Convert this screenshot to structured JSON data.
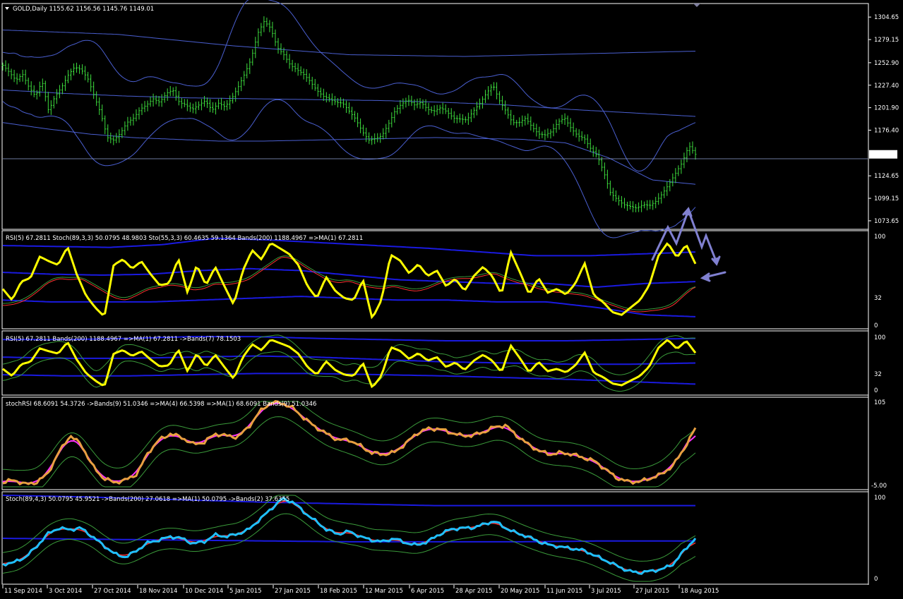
{
  "header": {
    "main": "GOLD,Daily  1155.62 1156.56 1145.76 1149.01",
    "rsi": "RSI(5) 67.2811  Stoch(89,3,3) 50.0795 48.9803  Sto(55,3,3) 60.4635 59.1364  Bands(200) 1188.4967  =>MA(1) 67.2811",
    "rsi2": "RSI(5) 67.2811  Bands(200) 1188.4967  =>MA(1) 67.2811  ->Bands(7) 78.1503",
    "stochrsi": "stochRSI 68.6091 54.3726  ->Bands(9) 51.0346  =>MA(4) 66.5398  =>MA(1) 68.6091  Bands(9) 51.0346",
    "stoch": "Stoch(89,4,3) 50.0795 45.9521  ->Bands(200) 27.0618  =>MA(1) 50.0795  ->Bands(2) 37.6355"
  },
  "colors": {
    "background": "#000000",
    "frame": "#ffffff",
    "candle": "#3ddc3d",
    "envelope": "#4a5fd0",
    "price_line": "#8fa0d0",
    "rsi": "#ffff00",
    "band_blue": "#1a1ae0",
    "stoch_red": "#ff3030",
    "stoch_green": "#3a9a3a",
    "srsi_orange": "#e8a040",
    "srsi_magenta": "#ff30ff",
    "stoch_cyan": "#20c0ff",
    "arrow": "#8080d0"
  },
  "chart_data": {
    "type": "line",
    "title": "GOLD,Daily",
    "ohlc_last": {
      "open": 1155.62,
      "high": 1156.56,
      "low": 1145.76,
      "close": 1149.01
    },
    "price_axis_ticks": [
      "1304.65",
      "1279.15",
      "1252.90",
      "1227.40",
      "1201.90",
      "1176.40",
      "1149.01",
      "1124.65",
      "1099.15",
      "1073.65"
    ],
    "price_range": [
      1064,
      1320
    ],
    "date_ticks": [
      "11 Sep 2014",
      "3 Oct 2014",
      "27 Oct 2014",
      "18 Nov 2014",
      "10 Dec 2014",
      "5 Jan 2015",
      "27 Jan 2015",
      "18 Feb 2015",
      "12 Mar 2015",
      "6 Apr 2015",
      "28 Apr 2015",
      "20 May 2015",
      "11 Jun 2015",
      "3 Jul 2015",
      "27 Jul 2015",
      "18 Aug 2015"
    ],
    "series": [
      {
        "name": "GOLD",
        "values": [
          1250,
          1242,
          1233,
          1240,
          1225,
          1215,
          1232,
          1198,
          1215,
          1225,
          1239,
          1248,
          1245,
          1235,
          1215,
          1195,
          1168,
          1165,
          1173,
          1185,
          1190,
          1200,
          1205,
          1212,
          1208,
          1218,
          1222,
          1208,
          1205,
          1200,
          1205,
          1210,
          1199,
          1207,
          1203,
          1212,
          1225,
          1240,
          1257,
          1286,
          1300,
          1292,
          1270,
          1262,
          1250,
          1245,
          1240,
          1232,
          1222,
          1215,
          1212,
          1208,
          1207,
          1198,
          1189,
          1175,
          1165,
          1167,
          1170,
          1183,
          1198,
          1206,
          1211,
          1205,
          1208,
          1200,
          1198,
          1202,
          1197,
          1190,
          1189,
          1188,
          1198,
          1207,
          1218,
          1228,
          1210,
          1198,
          1185,
          1185,
          1190,
          1180,
          1172,
          1171,
          1175,
          1186,
          1190,
          1178,
          1170,
          1167,
          1155,
          1147,
          1128,
          1105,
          1098,
          1092,
          1090,
          1088,
          1092,
          1091,
          1096,
          1105,
          1116,
          1128,
          1140,
          1159,
          1149.01
        ]
      },
      {
        "name": "RSI(5)",
        "values": [
          40,
          28,
          48,
          52,
          75,
          70,
          66,
          86,
          56,
          33,
          20,
          10,
          66,
          72,
          62,
          70,
          56,
          44,
          46,
          73,
          36,
          66,
          44,
          64,
          43,
          23,
          60,
          82,
          72,
          90,
          84,
          78,
          66,
          43,
          30,
          53,
          38,
          30,
          28,
          50,
          8,
          28,
          77,
          71,
          57,
          67,
          54,
          60,
          43,
          51,
          38,
          54,
          64,
          54,
          34,
          80,
          58,
          34,
          52,
          36,
          40,
          34,
          46,
          68,
          33,
          26,
          15,
          12,
          20,
          28,
          44,
          76,
          90,
          74,
          88,
          67.28
        ]
      },
      {
        "name": "Stoch(89)",
        "values": [
          20,
          22,
          28,
          40,
          55,
          62,
          60,
          62,
          52,
          42,
          32,
          28,
          36,
          45,
          48,
          52,
          50,
          44,
          46,
          54,
          52,
          55,
          60,
          72,
          84,
          96,
          92,
          80,
          70,
          60,
          55,
          58,
          52,
          48,
          46,
          50,
          45,
          42,
          46,
          54,
          60,
          62,
          62,
          66,
          70,
          62,
          56,
          52,
          46,
          42,
          40,
          38,
          36,
          30,
          24,
          18,
          12,
          10,
          12,
          14,
          20,
          36,
          50.08
        ]
      },
      {
        "name": "stochRSI",
        "values": [
          5,
          8,
          3,
          5,
          15,
          40,
          60,
          50,
          25,
          10,
          5,
          8,
          15,
          40,
          55,
          62,
          58,
          50,
          52,
          62,
          60,
          58,
          70,
          88,
          99,
          98,
          92,
          80,
          70,
          62,
          55,
          55,
          48,
          40,
          38,
          40,
          50,
          62,
          68,
          68,
          64,
          60,
          60,
          64,
          70,
          72,
          60,
          50,
          42,
          38,
          40,
          38,
          34,
          30,
          20,
          10,
          6,
          6,
          10,
          15,
          25,
          45,
          68.61
        ]
      }
    ]
  }
}
